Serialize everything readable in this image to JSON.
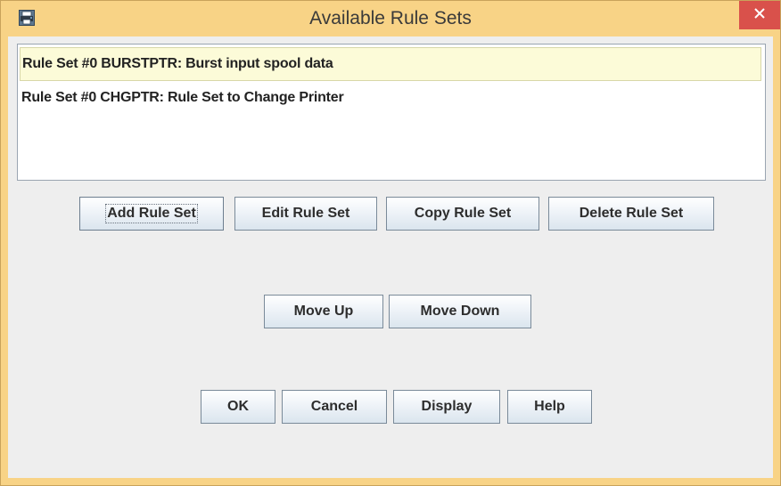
{
  "window": {
    "title": "Available Rule Sets",
    "icon": "printer-app-icon",
    "close_icon": "close-x-icon"
  },
  "rule_sets": [
    {
      "label": "Rule Set #0 BURSTPTR: Burst input spool data",
      "selected": true
    },
    {
      "label": "Rule Set #0 CHGPTR: Rule Set to Change Printer",
      "selected": false
    }
  ],
  "actions": {
    "add": "Add Rule Set",
    "edit": "Edit Rule Set",
    "copy": "Copy Rule Set",
    "delete": "Delete Rule Set"
  },
  "ordering": {
    "move_up": "Move Up",
    "move_down": "Move Down"
  },
  "footer": {
    "ok": "OK",
    "cancel": "Cancel",
    "display": "Display",
    "help": "Help"
  },
  "colors": {
    "frame": "#f8d386",
    "close_button": "#d9514b",
    "selection": "#fcfbd8"
  }
}
